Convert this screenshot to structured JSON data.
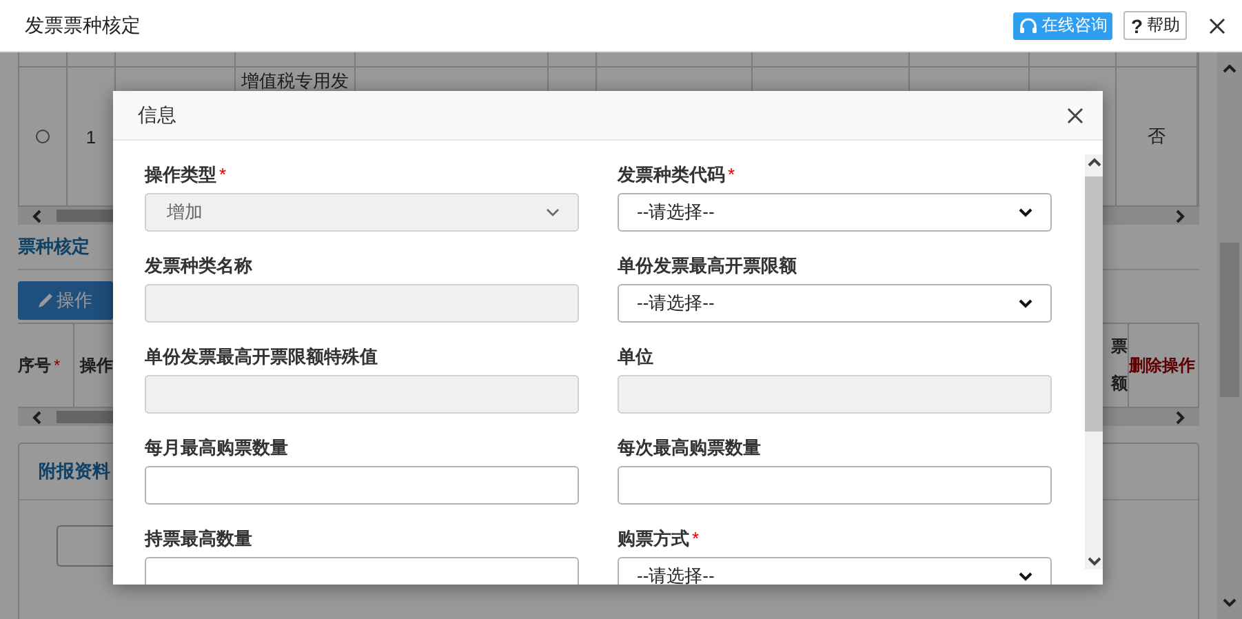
{
  "window": {
    "title": "发票票种核定",
    "consult_button": "在线咨询",
    "help_button": {
      "icon": "?",
      "label": "帮助"
    }
  },
  "top_table": {
    "rows": [
      {
        "selected": false,
        "index": "1",
        "name": "增值税专用发",
        "last": "否"
      }
    ]
  },
  "section_tab": "票种核定",
  "operate_button": "操作",
  "detail_table": {
    "index_header": "序号",
    "required": "*",
    "type_header": "操作",
    "limit_header": [
      "票",
      "额"
    ],
    "delete_header": "删除操作"
  },
  "attachment_tab": "附报资料",
  "dialog": {
    "title": "信息",
    "fields": [
      {
        "label": "操作类型",
        "required": true,
        "kind": "select",
        "value": "增加",
        "disabled": true
      },
      {
        "label": "发票种类代码",
        "required": true,
        "kind": "select",
        "value": "--请选择--",
        "disabled": false
      },
      {
        "label": "发票种类名称",
        "required": false,
        "kind": "text",
        "disabled": true
      },
      {
        "label": "单份发票最高开票限额",
        "required": false,
        "kind": "select",
        "value": "--请选择--",
        "disabled": false
      },
      {
        "label": "单份发票最高开票限额特殊值",
        "required": false,
        "kind": "text",
        "disabled": true
      },
      {
        "label": "单位",
        "required": false,
        "kind": "text",
        "disabled": true
      },
      {
        "label": "每月最高购票数量",
        "required": false,
        "kind": "text",
        "disabled": false
      },
      {
        "label": "每次最高购票数量",
        "required": false,
        "kind": "text",
        "disabled": false
      },
      {
        "label": "持票最高数量",
        "required": false,
        "kind": "text",
        "disabled": false
      },
      {
        "label": "购票方式",
        "required": true,
        "kind": "select",
        "value": "--请选择--",
        "disabled": false
      }
    ],
    "required_mark": "*"
  }
}
